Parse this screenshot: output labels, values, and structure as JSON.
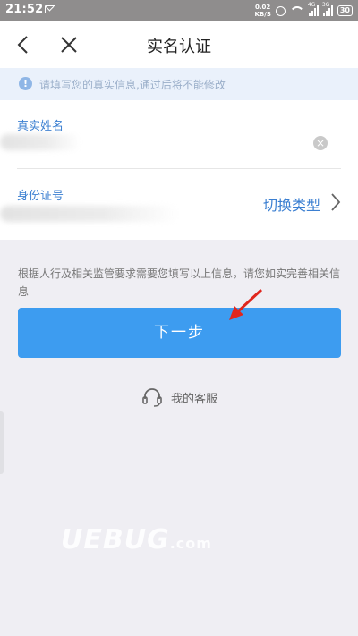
{
  "status_bar": {
    "time": "21:52",
    "speed_value": "0.02",
    "speed_unit": "KB/S",
    "network_tag_1": "4G",
    "network_tag_2": "3G",
    "battery": "30"
  },
  "header": {
    "title": "实名认证",
    "back_icon": "chevron-left-icon",
    "close_icon": "close-icon"
  },
  "notice": {
    "text": "请填写您的真实信息,通过后将不能修改",
    "icon": "info-icon"
  },
  "form": {
    "name_label": "真实姓名",
    "id_label": "身份证号",
    "switch_type_label": "切换类型"
  },
  "hint_text": "根据人行及相关监管要求需要您填写以上信息，请您如实完善相关信息",
  "next_button_label": "下一步",
  "customer_service_label": "我的客服",
  "watermark": {
    "main": "UEBUG",
    "suffix": ".com"
  },
  "colors": {
    "accent": "#3d9cf0",
    "label_blue": "#3b7fd1",
    "annotation_red": "#e0261d"
  }
}
